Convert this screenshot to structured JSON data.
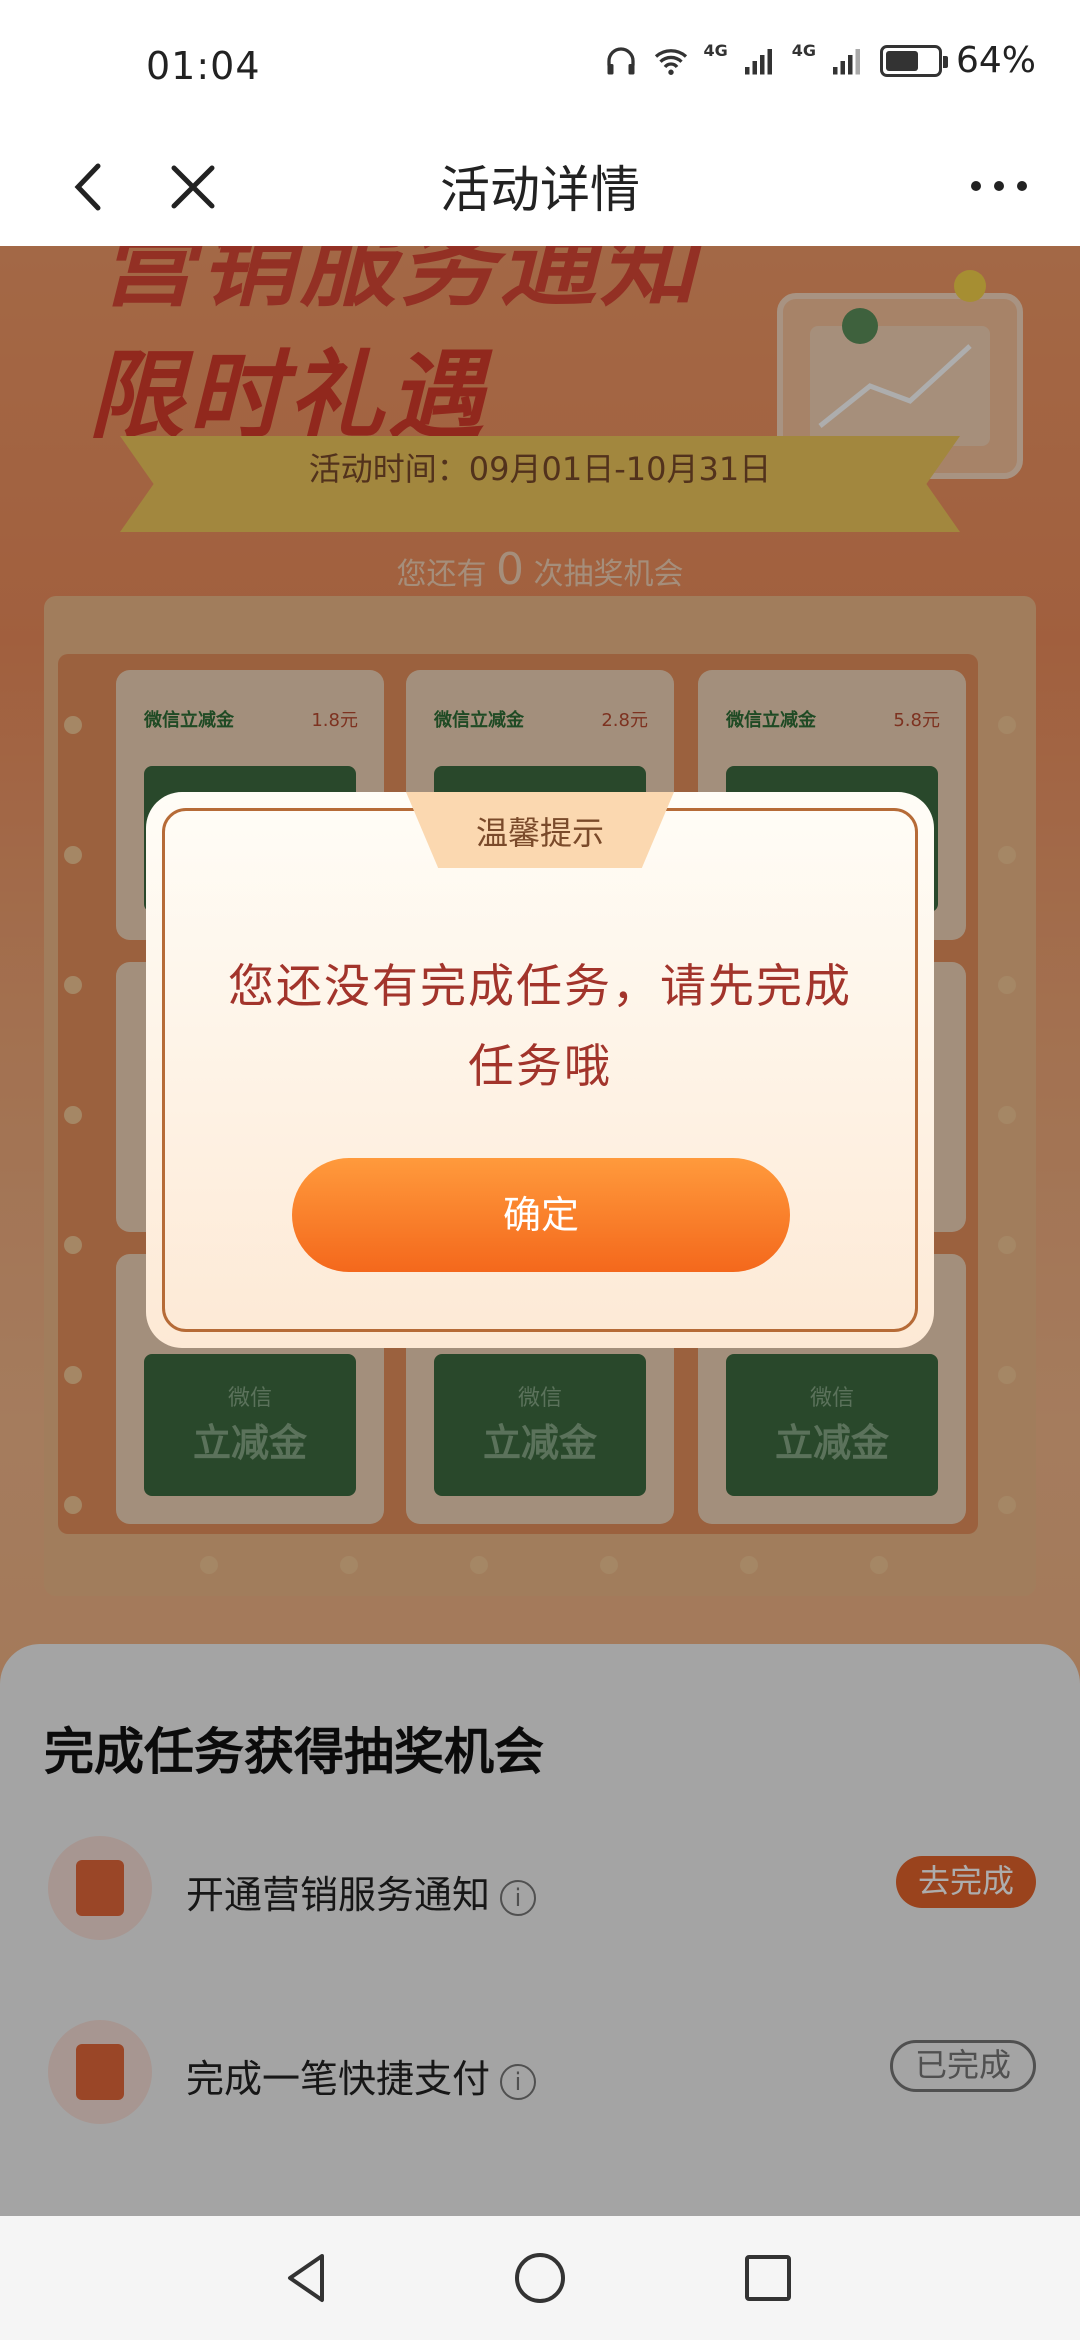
{
  "status_bar": {
    "time": "01:04",
    "battery_percent_text": "64%",
    "battery_level": 0.64,
    "network_1": "4G",
    "network_2": "4G"
  },
  "title_bar": {
    "title": "活动详情"
  },
  "activity": {
    "banner_line_1": "营销服务通知",
    "banner_line_2": "限时礼遇",
    "time_label": "活动时间：09月01日-10月31日",
    "chances_prefix": "您还有",
    "chances_count": "0",
    "chances_suffix": "次抽奖机会",
    "prizes": [
      {
        "name": "微信立减金",
        "amount": "1.8元"
      },
      {
        "name": "微信立减金",
        "amount": "2.8元"
      },
      {
        "name": "微信立减金",
        "amount": "5.8元"
      }
    ],
    "card_small": "微信",
    "card_big": "立减金"
  },
  "dialog": {
    "tab_title": "温馨提示",
    "message_line_1": "您还没有完成任务，请先完成",
    "message_line_2": "任务哦",
    "confirm_label": "确定"
  },
  "tasks": {
    "heading": "完成任务获得抽奖机会",
    "items": [
      {
        "label": "开通营销服务通知",
        "info": "i",
        "button": "去完成"
      },
      {
        "label": "完成一笔快捷支付",
        "info": "i",
        "button": "已完成"
      }
    ]
  },
  "colors": {
    "accent": "#f4681c",
    "dialog_text": "#a2342b",
    "go_button": "#e4632b"
  }
}
